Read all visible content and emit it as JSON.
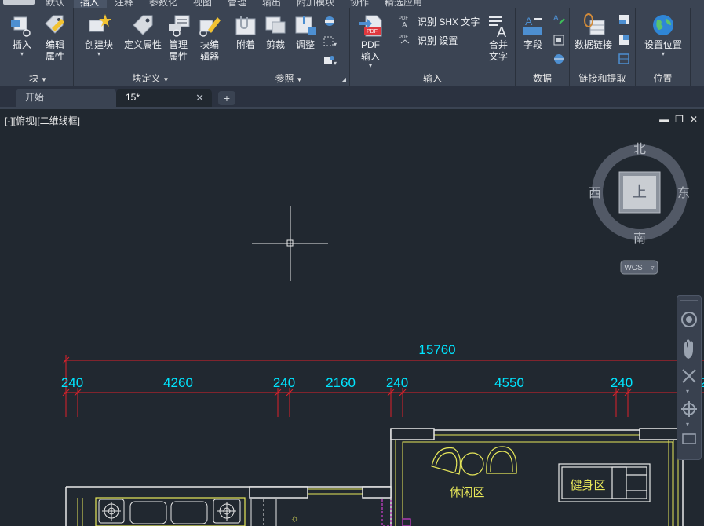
{
  "menu_tabs": [
    "默认",
    "插入",
    "注释",
    "参数化",
    "视图",
    "管理",
    "输出",
    "附加模块",
    "协作",
    "精选应用"
  ],
  "active_menu_tab": "插入",
  "ribbon": {
    "block_panel": {
      "title": "块",
      "buttons": [
        {
          "label": "插入",
          "icon": "insert-block-icon"
        },
        {
          "label": "编辑属性",
          "icon": "edit-attribute-icon"
        }
      ]
    },
    "block_def_panel": {
      "title": "块定义",
      "buttons": [
        {
          "label": "创建块",
          "icon": "create-block-icon"
        },
        {
          "label": "定义属性",
          "icon": "define-attribute-icon"
        },
        {
          "label": "管理属性",
          "icon": "manage-attributes-icon"
        },
        {
          "label": "块编辑器",
          "icon": "block-editor-icon"
        }
      ]
    },
    "reference_panel": {
      "title": "参照",
      "buttons": [
        {
          "label": "附着",
          "icon": "attach-icon"
        },
        {
          "label": "剪裁",
          "icon": "clip-icon"
        },
        {
          "label": "调整",
          "icon": "adjust-icon"
        }
      ]
    },
    "import_panel": {
      "title": "输入",
      "pdf_button": {
        "label": "PDF输入",
        "badge": "PDF"
      },
      "recognize_shx": "识别 SHX 文字",
      "recognize_settings": "识别 设置",
      "combine_text": "合并文字"
    },
    "data_panel": {
      "title": "数据",
      "field_button": "字段"
    },
    "link_panel": {
      "title": "链接和提取",
      "data_link_button": "数据链接"
    },
    "location_panel": {
      "title": "位置",
      "set_location_button": "设置位置"
    }
  },
  "doc_tabs": [
    {
      "label": "开始"
    },
    {
      "label": "15*"
    }
  ],
  "add_tab_label": "+",
  "viewport_label": "[-][俯视][二维线框]",
  "window_controls": [
    "▬",
    "❐",
    "✕"
  ],
  "viewcube": {
    "north": "北",
    "south": "南",
    "east": "东",
    "west": "西",
    "face": "上",
    "wcs": "WCS"
  },
  "dimensions": {
    "total": "15760",
    "segments": [
      "240",
      "4260",
      "240",
      "2160",
      "240",
      "4550",
      "240",
      "2"
    ]
  },
  "room_labels": [
    "休闲区",
    "健身区"
  ],
  "colors": {
    "ribbon_bg": "#3b4453",
    "canvas_bg": "#212830",
    "dimension_line": "#e0202a",
    "dimension_text": "#00e5ff",
    "wall_yellow": "#e8e85a",
    "furniture_white": "#e8e8e8"
  }
}
